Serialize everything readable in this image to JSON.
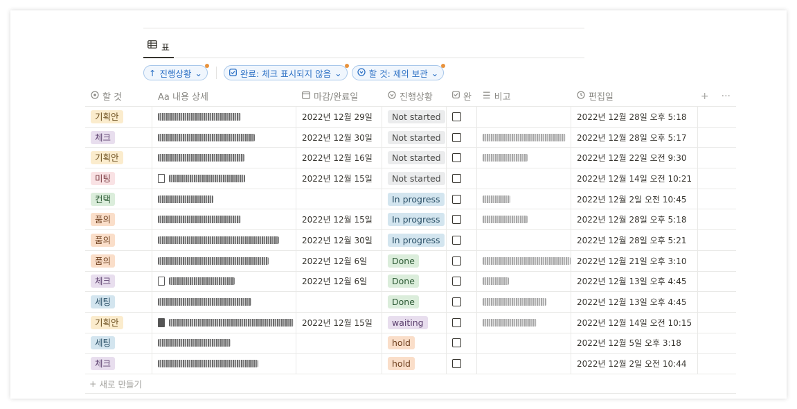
{
  "tab": {
    "icon": "table-icon",
    "label": "표"
  },
  "filters": [
    {
      "icon": "arrow-up-icon",
      "label": "진행상황"
    },
    {
      "icon": "checkbox-icon",
      "label": "완료: 체크 표시되지 않음"
    },
    {
      "icon": "status-icon",
      "label": "할 것: 제외 보관"
    }
  ],
  "columns": [
    {
      "icon": "status-icon",
      "label": "할 것"
    },
    {
      "icon": "text-icon",
      "label": "Aa 내용 상세"
    },
    {
      "icon": "calendar-icon",
      "label": "마감/완료일"
    },
    {
      "icon": "status-icon",
      "label": "진행상황"
    },
    {
      "icon": "checkbox-icon",
      "label": "완"
    },
    {
      "icon": "lines-icon",
      "label": "비고"
    },
    {
      "icon": "clock-icon",
      "label": "편집일"
    }
  ],
  "tag_colors": {
    "기획안": {
      "bg": "#fbeccd",
      "fg": "#6b4e1e"
    },
    "체크": {
      "bg": "#e8deee",
      "fg": "#5b3f6d"
    },
    "미팅": {
      "bg": "#f9e2e4",
      "fg": "#7a3a40"
    },
    "컨택": {
      "bg": "#dbeddb",
      "fg": "#2d5a35"
    },
    "품의": {
      "bg": "#fadec9",
      "fg": "#6e3f1e"
    },
    "세팅": {
      "bg": "#d3e5ef",
      "fg": "#2a4f66"
    }
  },
  "status_colors": {
    "Not started": {
      "bg": "#ebeced",
      "fg": "#4a4a48"
    },
    "In progress": {
      "bg": "#d3e5ef",
      "fg": "#2a4f66"
    },
    "Done": {
      "bg": "#dbeddb",
      "fg": "#2d5a35"
    },
    "waiting": {
      "bg": "#e8deee",
      "fg": "#5b3f6d"
    },
    "hold": {
      "bg": "#fadec9",
      "fg": "#6e3f1e"
    }
  },
  "rows": [
    {
      "tag": "기획안",
      "content_doc": "",
      "content_width": 120,
      "date": "2022년 12월 29일",
      "status": "Not started",
      "note_width": 0,
      "edited": "2022년 12월 28일 오후 5:18"
    },
    {
      "tag": "체크",
      "content_doc": "",
      "content_width": 140,
      "date": "2022년 12월 30일",
      "status": "Not started",
      "note_width": 120,
      "edited": "2022년 12월 28일 오후 5:17"
    },
    {
      "tag": "기획안",
      "content_doc": "",
      "content_width": 125,
      "date": "2022년 12월 16일",
      "status": "Not started",
      "note_width": 65,
      "edited": "2022년 12월 22일 오전 9:30"
    },
    {
      "tag": "미팅",
      "content_doc": "outline",
      "content_width": 110,
      "date": "2022년 12월 15일",
      "status": "Not started",
      "note_width": 0,
      "edited": "2022년 12월 14일 오전 10:21"
    },
    {
      "tag": "컨택",
      "content_doc": "",
      "content_width": 80,
      "date": "",
      "status": "In progress",
      "note_width": 40,
      "edited": "2022년 12월 2일 오전 10:45"
    },
    {
      "tag": "품의",
      "content_doc": "",
      "content_width": 120,
      "date": "2022년 12월 15일",
      "status": "In progress",
      "note_width": 65,
      "edited": "2022년 12월 28일 오후 5:18"
    },
    {
      "tag": "품의",
      "content_doc": "",
      "content_width": 175,
      "date": "2022년 12월 30일",
      "status": "In progress",
      "note_width": 0,
      "edited": "2022년 12월 28일 오후 5:21"
    },
    {
      "tag": "품의",
      "content_doc": "",
      "content_width": 160,
      "date": "2022년 12월 6일",
      "status": "Done",
      "note_width": 128,
      "edited": "2022년 12월 21일 오후 3:10"
    },
    {
      "tag": "체크",
      "content_doc": "outline",
      "content_width": 95,
      "date": "2022년 12월 6일",
      "status": "Done",
      "note_width": 38,
      "edited": "2022년 12월 13일 오후 4:45"
    },
    {
      "tag": "세팅",
      "content_doc": "",
      "content_width": 135,
      "date": "",
      "status": "Done",
      "note_width": 92,
      "edited": "2022년 12월 13일 오후 4:45"
    },
    {
      "tag": "기획안",
      "content_doc": "filled",
      "content_width": 180,
      "date": "2022년 12월 15일",
      "status": "waiting",
      "note_width": 78,
      "edited": "2022년 12월 14일 오전 10:15"
    },
    {
      "tag": "세팅",
      "content_doc": "",
      "content_width": 105,
      "date": "",
      "status": "hold",
      "note_width": 0,
      "edited": "2022년 12월 5일 오후 3:18"
    },
    {
      "tag": "체크",
      "content_doc": "",
      "content_width": 145,
      "date": "",
      "status": "hold",
      "note_width": 0,
      "edited": "2022년 12월 2일 오전 10:44"
    }
  ],
  "new_row_label": "새로 만들기"
}
